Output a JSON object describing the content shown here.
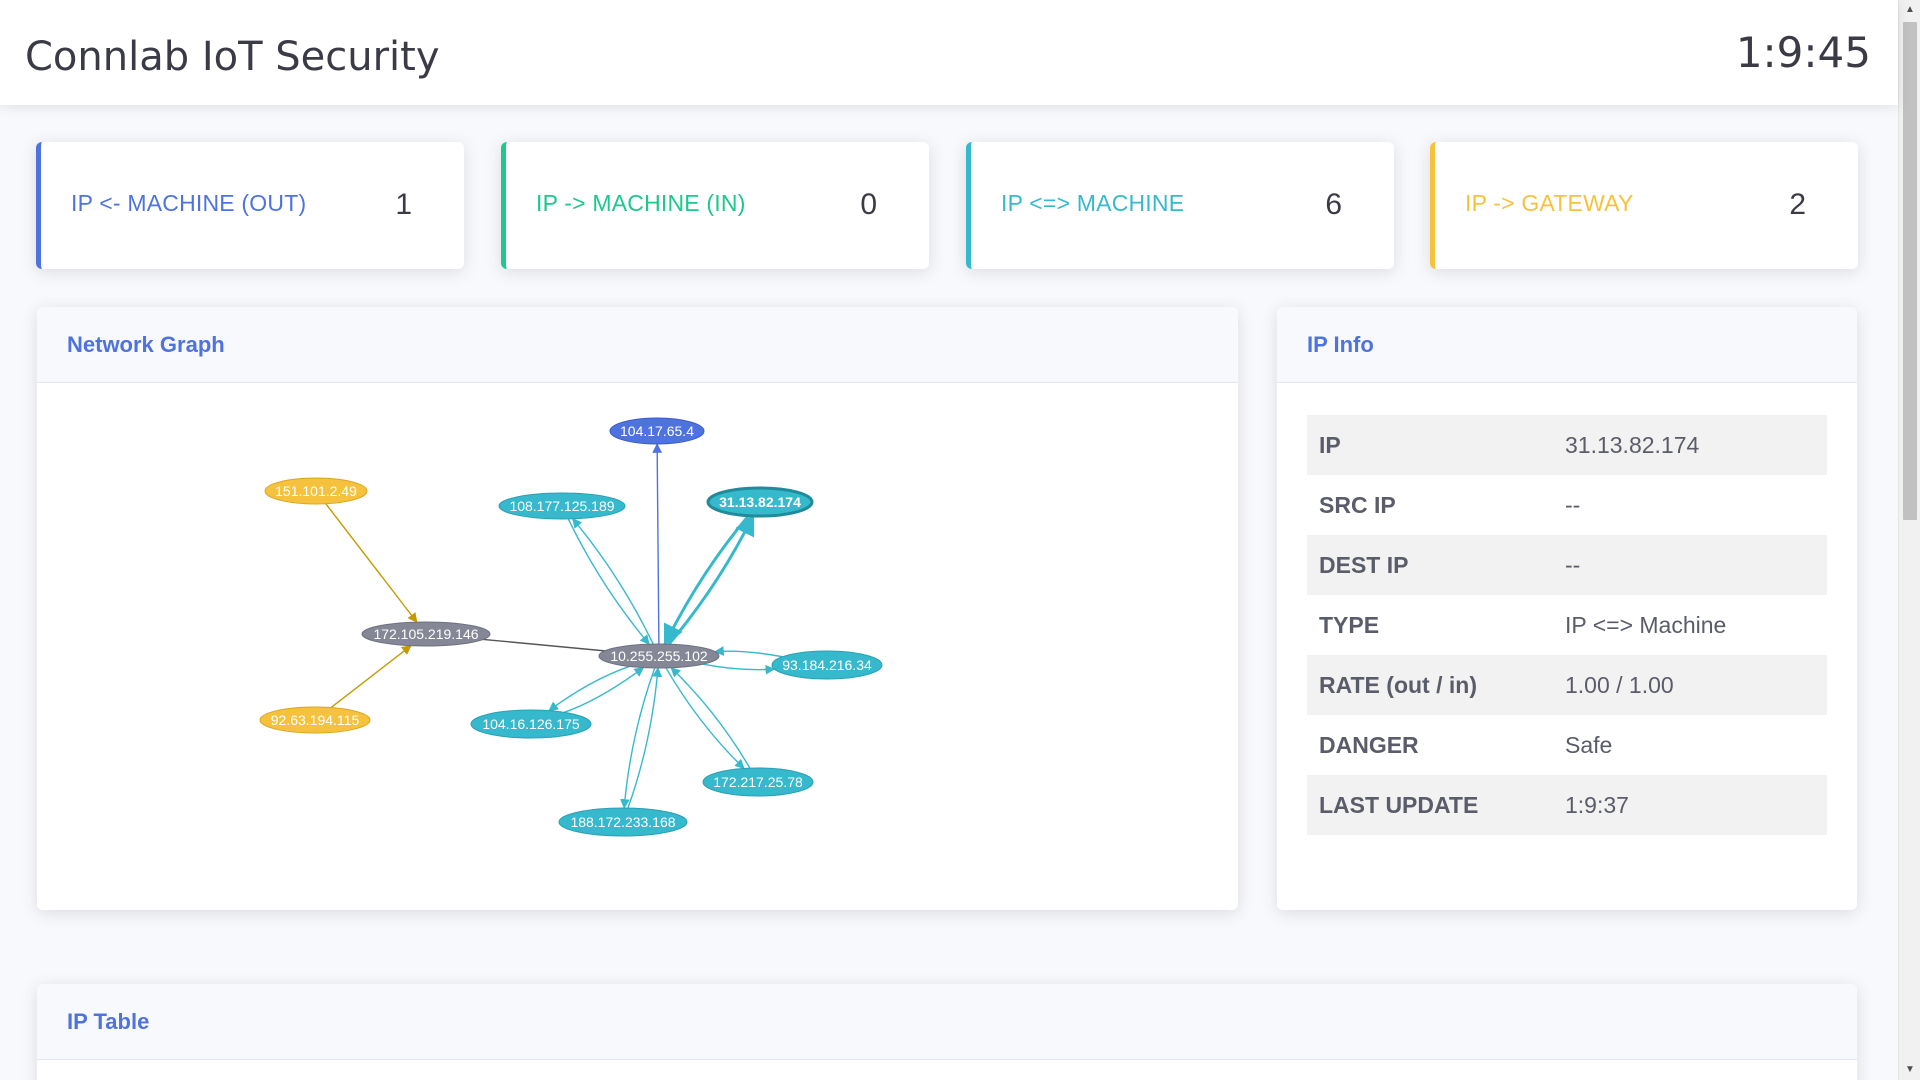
{
  "app": {
    "title": "Connlab IoT Security",
    "clock": "1:9:45"
  },
  "stats": [
    {
      "label": "IP <- MACHINE (OUT)",
      "value": "1",
      "color": "#4e73df"
    },
    {
      "label": "IP -> MACHINE (IN)",
      "value": "0",
      "color": "#1cc88a"
    },
    {
      "label": "IP <=> MACHINE",
      "value": "6",
      "color": "#36b9cc"
    },
    {
      "label": "IP -> GATEWAY",
      "value": "2",
      "color": "#f6c23e"
    }
  ],
  "network_graph": {
    "title": "Network Graph",
    "nodes": [
      {
        "id": "10.255.255.102",
        "color": "#858796"
      },
      {
        "id": "172.105.219.146",
        "color": "#858796"
      },
      {
        "id": "104.17.65.4",
        "color": "#4e73df"
      },
      {
        "id": "151.101.2.49",
        "color": "#f6c23e"
      },
      {
        "id": "92.63.194.115",
        "color": "#f6c23e"
      },
      {
        "id": "108.177.125.189",
        "color": "#36b9cc"
      },
      {
        "id": "31.13.82.174",
        "color": "#36b9cc",
        "selected": true
      },
      {
        "id": "93.184.216.34",
        "color": "#36b9cc"
      },
      {
        "id": "104.16.126.175",
        "color": "#36b9cc"
      },
      {
        "id": "172.217.25.78",
        "color": "#36b9cc"
      },
      {
        "id": "188.172.233.168",
        "color": "#36b9cc"
      }
    ],
    "edges": [
      {
        "from": "10.255.255.102",
        "to": "104.17.65.4",
        "color": "#4e73df",
        "arrow": true
      },
      {
        "from": "151.101.2.49",
        "to": "172.105.219.146",
        "color": "#c49a00",
        "arrow": true
      },
      {
        "from": "92.63.194.115",
        "to": "172.105.219.146",
        "color": "#c49a00",
        "arrow": true
      },
      {
        "from": "172.105.219.146",
        "to": "10.255.255.102",
        "color": "#555555",
        "arrow": false
      }
    ],
    "bidirectional": [
      "108.177.125.189",
      "31.13.82.174",
      "93.184.216.34",
      "104.16.126.175",
      "172.217.25.78",
      "188.172.233.168"
    ],
    "bidirectional_color": "#36b9cc"
  },
  "ip_info": {
    "title": "IP Info",
    "rows": [
      {
        "key": "IP",
        "value": "31.13.82.174"
      },
      {
        "key": "SRC IP",
        "value": "--"
      },
      {
        "key": "DEST IP",
        "value": "--"
      },
      {
        "key": "TYPE",
        "value": "IP <=> Machine"
      },
      {
        "key": "RATE (out / in)",
        "value": "1.00 / 1.00"
      },
      {
        "key": "DANGER",
        "value": "Safe"
      },
      {
        "key": "LAST UPDATE",
        "value": "1:9:37"
      }
    ]
  },
  "ip_table": {
    "title": "IP Table"
  }
}
